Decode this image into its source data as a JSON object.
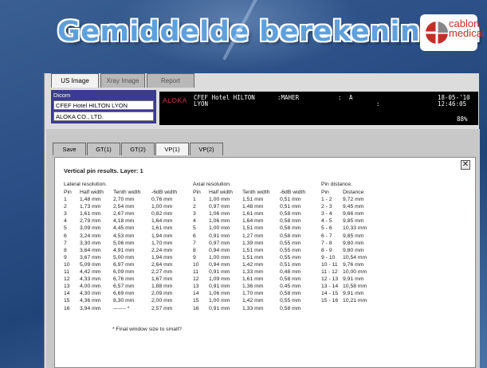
{
  "slide": {
    "title": "Gemiddelde berekeningen",
    "logo_text_top": "cablon",
    "logo_text_bottom": "medical",
    "logo_colors": [
      "#c62d27",
      "#7a7a7a"
    ]
  },
  "top_tabs": [
    "US Image",
    "Xray Image",
    "Report"
  ],
  "dicom": {
    "label": "Dicom",
    "fields": [
      "CFEF Hotel HILTON  LYON",
      "ALOKA CO., LTD."
    ]
  },
  "monitor": {
    "brand": "ALOKA",
    "institution": "CFEF Hotel HILTON",
    "institution_line2": "LYON",
    "operator": ":MAHER",
    "col_a": ":",
    "col_b": "A",
    "col_c": ":",
    "date": "18-05-'10",
    "time": "12:46:05",
    "percent": "88%"
  },
  "sub_tabs": [
    "Save",
    "GT(1)",
    "GT(2)",
    "VP(1)",
    "VP(2)"
  ],
  "results": {
    "title": "Vertical pin results. Layer: 1",
    "lateral": {
      "heading": "Lateral resolution.",
      "columns": [
        "Pin",
        "Half width",
        "Tenth width",
        "-6dB width"
      ],
      "rows": [
        [
          "1",
          "1,48 mm",
          "2,70 mm",
          "0,76 mm"
        ],
        [
          "2",
          "1,73 mm",
          "2,54 mm",
          "1,00 mm"
        ],
        [
          "3",
          "1,61 mm",
          "2,67 mm",
          "0,82 mm"
        ],
        [
          "4",
          "2,79 mm",
          "4,18 mm",
          "1,64 mm"
        ],
        [
          "5",
          "3,09 mm",
          "4,45 mm",
          "1,61 mm"
        ],
        [
          "6",
          "3,24 mm",
          "4,53 mm",
          "1,94 mm"
        ],
        [
          "7",
          "3,30 mm",
          "5,06 mm",
          "1,70 mm"
        ],
        [
          "8",
          "3,64 mm",
          "4,91 mm",
          "2,24 mm"
        ],
        [
          "9",
          "3,67 mm",
          "5,00 mm",
          "1,94 mm"
        ],
        [
          "10",
          "5,09 mm",
          "6,97 mm",
          "2,64 mm"
        ],
        [
          "11",
          "4,42 mm",
          "6,09 mm",
          "2,27 mm"
        ],
        [
          "12",
          "4,33 mm",
          "6,76 mm",
          "1,67 mm"
        ],
        [
          "13",
          "4,00 mm",
          "6,57 mm",
          "1,88 mm"
        ],
        [
          "14",
          "4,30 mm",
          "6,69 mm",
          "2,09 mm"
        ],
        [
          "15",
          "4,36 mm",
          "8,30 mm",
          "2,00 mm"
        ],
        [
          "16",
          "3,94 mm",
          "-------  *",
          "2,57 mm"
        ]
      ]
    },
    "axial": {
      "heading": "Axial resolution.",
      "columns": [
        "Pin",
        "Half width",
        "Tenth width",
        "-6dB width"
      ],
      "rows": [
        [
          "1",
          "1,00 mm",
          "1,51 mm",
          "0,51 mm"
        ],
        [
          "2",
          "0,97 mm",
          "1,48 mm",
          "0,51 mm"
        ],
        [
          "3",
          "1,06 mm",
          "1,61 mm",
          "0,58 mm"
        ],
        [
          "4",
          "1,06 mm",
          "1,64 mm",
          "0,58 mm"
        ],
        [
          "5",
          "1,00 mm",
          "1,51 mm",
          "0,58 mm"
        ],
        [
          "6",
          "0,91 mm",
          "1,27 mm",
          "0,58 mm"
        ],
        [
          "7",
          "0,97 mm",
          "1,39 mm",
          "0,55 mm"
        ],
        [
          "8",
          "0,94 mm",
          "1,51 mm",
          "0,55 mm"
        ],
        [
          "9",
          "1,00 mm",
          "1,51 mm",
          "0,55 mm"
        ],
        [
          "10",
          "0,94 mm",
          "1,42 mm",
          "0,51 mm"
        ],
        [
          "11",
          "0,91 mm",
          "1,33 mm",
          "0,48 mm"
        ],
        [
          "12",
          "1,09 mm",
          "1,61 mm",
          "0,58 mm"
        ],
        [
          "13",
          "0,91 mm",
          "1,36 mm",
          "0,45 mm"
        ],
        [
          "14",
          "1,06 mm",
          "1,70 mm",
          "0,58 mm"
        ],
        [
          "15",
          "1,00 mm",
          "1,42 mm",
          "0,55 mm"
        ],
        [
          "16",
          "0,91 mm",
          "1,33 mm",
          "0,58 mm"
        ]
      ]
    },
    "pin_distance": {
      "heading": "Pin distance.",
      "columns": [
        "Pin",
        "Distance"
      ],
      "rows": [
        [
          "1 - 2",
          "9,72 mm"
        ],
        [
          "2 - 3",
          "9,45 mm"
        ],
        [
          "3 - 4",
          "9,66 mm"
        ],
        [
          "4 - 5",
          "9,85 mm"
        ],
        [
          "5 - 6",
          "10,33 mm"
        ],
        [
          "6 - 7",
          "9,85 mm"
        ],
        [
          "7 - 8",
          "9,80 mm"
        ],
        [
          "8 - 9",
          "9,80 mm"
        ],
        [
          "9 - 10",
          "10,54 mm"
        ],
        [
          "10 - 11",
          "9,76 mm"
        ],
        [
          "11 - 12",
          "10,00 mm"
        ],
        [
          "12 - 13",
          "9,91 mm"
        ],
        [
          "13 - 14",
          "10,58 mm"
        ],
        [
          "14 - 15",
          "9,91 mm"
        ],
        [
          "15 - 16",
          "10,21 mm"
        ]
      ]
    },
    "footnote": "*  Final window size to small?"
  }
}
